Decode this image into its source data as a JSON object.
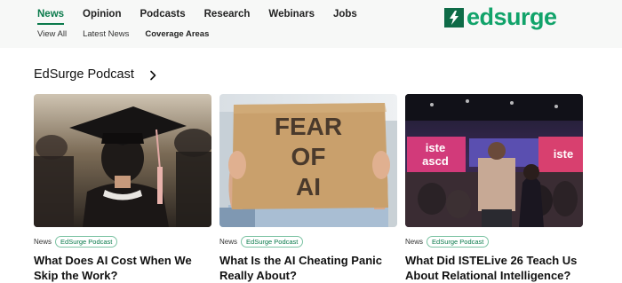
{
  "nav": {
    "primary": [
      {
        "label": "News",
        "active": true
      },
      {
        "label": "Opinion"
      },
      {
        "label": "Podcasts"
      },
      {
        "label": "Research"
      },
      {
        "label": "Webinars"
      },
      {
        "label": "Jobs"
      }
    ],
    "secondary": [
      {
        "label": "View All"
      },
      {
        "label": "Latest News"
      },
      {
        "label": "Coverage Areas",
        "bold": true
      }
    ]
  },
  "logo": {
    "text": "edsurge",
    "icon": "lightning-bolt-icon",
    "brand_color": "#11a36a",
    "mark_color": "#0e6b47"
  },
  "section": {
    "title": "EdSurge Podcast",
    "icon": "chevron-right-icon"
  },
  "cards": [
    {
      "category": "News",
      "badge": "EdSurge Podcast",
      "title": "What Does AI Cost When We Skip the Work?",
      "image": "graduate-cap-photo"
    },
    {
      "category": "News",
      "badge": "EdSurge Podcast",
      "title": "What Is the AI Cheating Panic Really About?",
      "image": "fear-of-ai-sign-photo",
      "sign_text": [
        "FEAR",
        "OF",
        "AI"
      ]
    },
    {
      "category": "News",
      "badge": "EdSurge Podcast",
      "title": "What Did ISTELive 26 Teach Us About Relational Intelligence?",
      "image": "iste-conference-photo",
      "screen_text": "iste\nascd",
      "screen_text_right": "iste"
    }
  ],
  "colors": {
    "accent": "#0a7a4b",
    "header_bg": "#f7f8f7"
  }
}
